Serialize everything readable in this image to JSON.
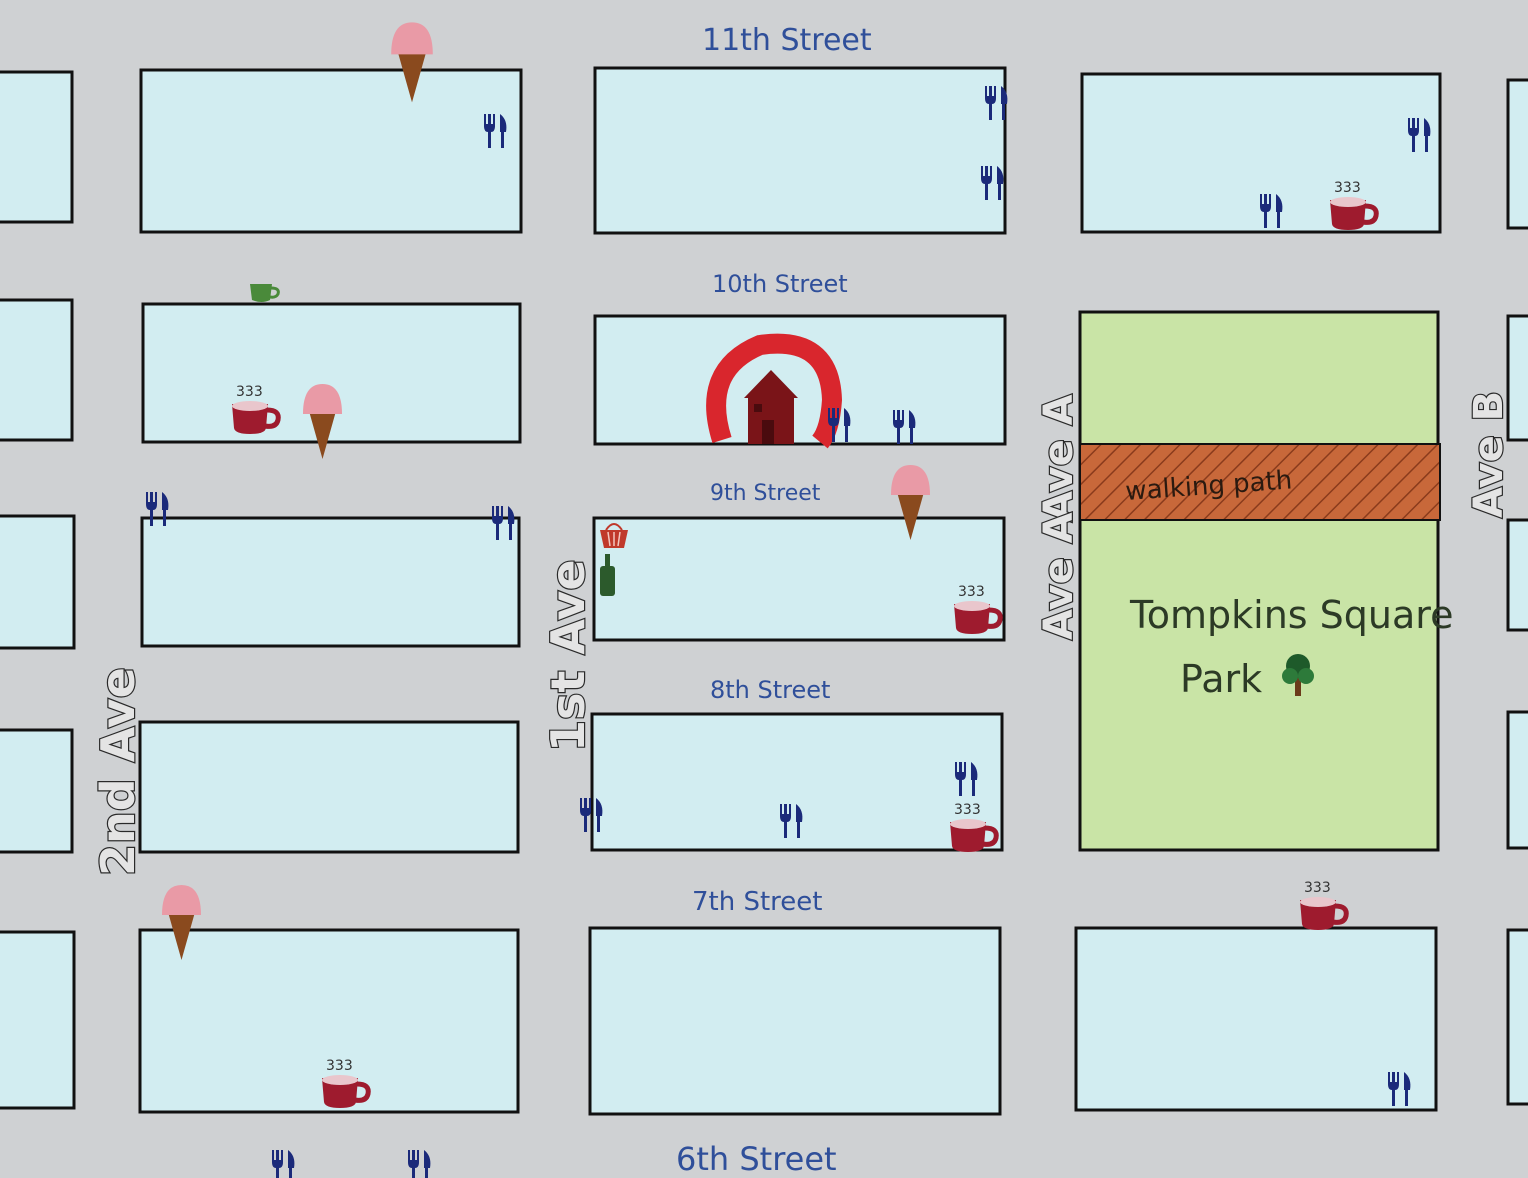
{
  "map": {
    "streets": {
      "s11": "11th Street",
      "s10": "10th Street",
      "s9": "9th Street",
      "s8": "8th Street",
      "s7": "7th Street",
      "s6": "6th Street"
    },
    "avenues": {
      "second": "2nd Ave",
      "first": "1st Ave",
      "a_north": "Ave A",
      "a_south": "Ave A",
      "b": "Ave B"
    },
    "park": {
      "line1": "Tompkins Square",
      "line2": "Park"
    },
    "walking_path": "walking path"
  },
  "colors": {
    "block": "#d2edf1",
    "park": "#c9e4a6",
    "road": "#cfd1d3",
    "walking_path": "#c8683a",
    "street_text": "#2f4f9a",
    "cutlery": "#1b2a7a",
    "coffee": "#9e1b2e",
    "ice_cream": "#e99aa6",
    "landmark_ring": "#d9262d"
  },
  "legend_icons": [
    "cutlery-icon",
    "coffee-cup-icon",
    "ice-cream-icon",
    "green-tea-cup-icon",
    "basket-icon",
    "bottle-icon",
    "house-landmark-icon",
    "tree-icon"
  ]
}
